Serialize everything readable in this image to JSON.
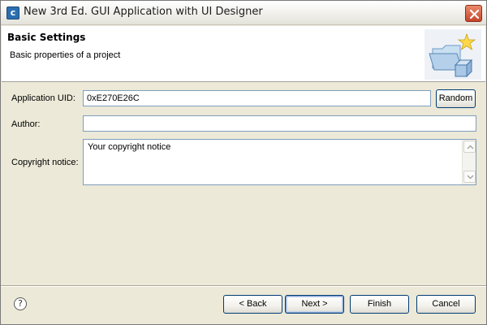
{
  "window": {
    "title": "New 3rd Ed. GUI Application with UI Designer",
    "app_icon_glyph": "c"
  },
  "header": {
    "title": "Basic Settings",
    "description": "Basic properties of a project",
    "banner_icon": "folder-star-icon"
  },
  "form": {
    "uid_label": "Application UID:",
    "uid_value": "0xE270E26C",
    "random_label": "Random",
    "author_label": "Author:",
    "author_value": "",
    "copyright_label": "Copyright notice:",
    "copyright_value": "Your copyright notice"
  },
  "footer": {
    "help_glyph": "?",
    "back_label": "< Back",
    "next_label": "Next >",
    "finish_label": "Finish",
    "cancel_label": "Cancel"
  },
  "colors": {
    "dialog_bg": "#ece9d8",
    "field_border": "#7f9db9",
    "button_border": "#003c74",
    "close_red": "#c6452a"
  }
}
